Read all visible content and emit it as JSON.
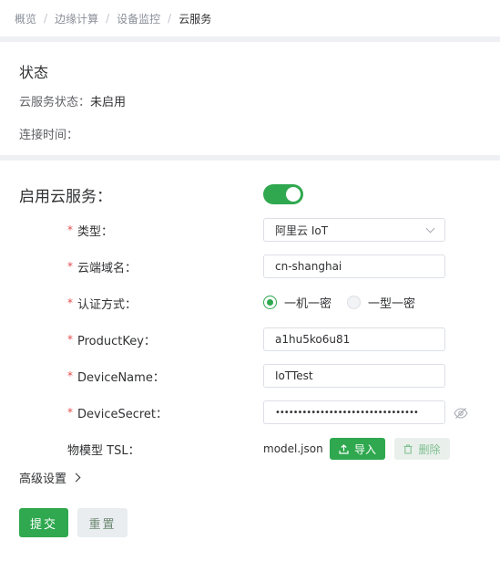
{
  "breadcrumb": {
    "items": [
      "概览",
      "边缘计算",
      "设备监控",
      "云服务"
    ],
    "separator": "/"
  },
  "status": {
    "title": "状态",
    "cloud_status_label": "云服务状态：",
    "cloud_status_value": "未启用",
    "connect_time_label": "连接时间："
  },
  "form": {
    "enable_label": "启用云服务：",
    "enable_switch_on": true,
    "required_mark": "*",
    "type_label": "类型：",
    "type_value": "阿里云 IoT",
    "domain_label": "云端域名：",
    "domain_value": "cn-shanghai",
    "auth_label": "认证方式：",
    "auth_options": [
      {
        "label": "一机一密",
        "checked": true
      },
      {
        "label": "一型一密",
        "checked": false
      }
    ],
    "product_key_label": "ProductKey：",
    "product_key_value": "a1hu5ko6u81",
    "device_name_label": "DeviceName：",
    "device_name_value": "IoTTest",
    "device_secret_label": "DeviceSecret：",
    "device_secret_masked": "••••••••••••••••••••••••••••••••",
    "tsl_label": "物模型 TSL：",
    "tsl_file": "model.json",
    "import_button": "导入",
    "delete_button": "删除",
    "advanced_label": "高级设置"
  },
  "actions": {
    "submit_label": "提交",
    "reset_label": "重置"
  },
  "colors": {
    "accent": "#2fa84f",
    "required": "#e34d4d",
    "divider": "#eef0f4"
  },
  "icons": {
    "eye": "eye-off-icon",
    "import": "upload-icon",
    "delete": "trash-icon",
    "select_arrow": "chevron-down-icon",
    "advanced": "chevron-right-icon"
  }
}
